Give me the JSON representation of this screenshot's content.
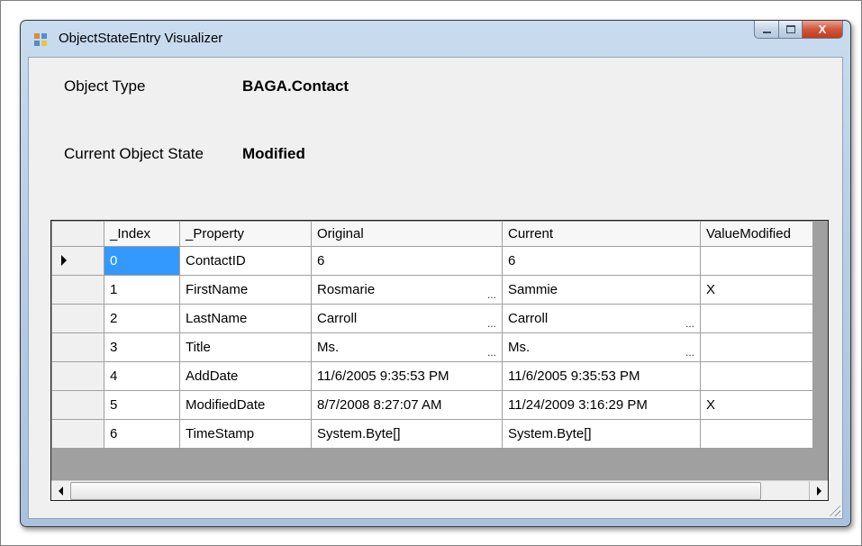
{
  "window": {
    "title": "ObjectStateEntry Visualizer",
    "icon": "app-window-icon",
    "controls": {
      "minimize": "minimize-icon",
      "maximize": "maximize-icon",
      "close": "X"
    }
  },
  "fields": {
    "object_type_label": "Object Type",
    "object_type_value": "BAGA.Contact",
    "state_label": "Current Object State",
    "state_value": "Modified"
  },
  "grid": {
    "columns": [
      "_Index",
      "_Property",
      "Original",
      "Current",
      "ValueModified"
    ],
    "rows": [
      {
        "index": "0",
        "property": "ContactID",
        "original": "6",
        "current": "6",
        "modified": ""
      },
      {
        "index": "1",
        "property": "FirstName",
        "original": "Rosmarie",
        "current": "Sammie",
        "modified": "X"
      },
      {
        "index": "2",
        "property": "LastName",
        "original": "Carroll",
        "current": "Carroll",
        "modified": ""
      },
      {
        "index": "3",
        "property": "Title",
        "original": "Ms.",
        "current": "Ms.",
        "modified": ""
      },
      {
        "index": "4",
        "property": "AddDate",
        "original": "11/6/2005 9:35:53 PM",
        "current": "11/6/2005 9:35:53 PM",
        "modified": ""
      },
      {
        "index": "5",
        "property": "ModifiedDate",
        "original": "8/7/2008 8:27:07 AM",
        "current": "11/24/2009 3:16:29 PM",
        "modified": "X"
      },
      {
        "index": "6",
        "property": "TimeStamp",
        "original": "System.Byte[]",
        "current": "System.Byte[]",
        "modified": ""
      }
    ],
    "ellipsis": "...",
    "selected_cell": "0",
    "selection_color": "#3399ff"
  }
}
